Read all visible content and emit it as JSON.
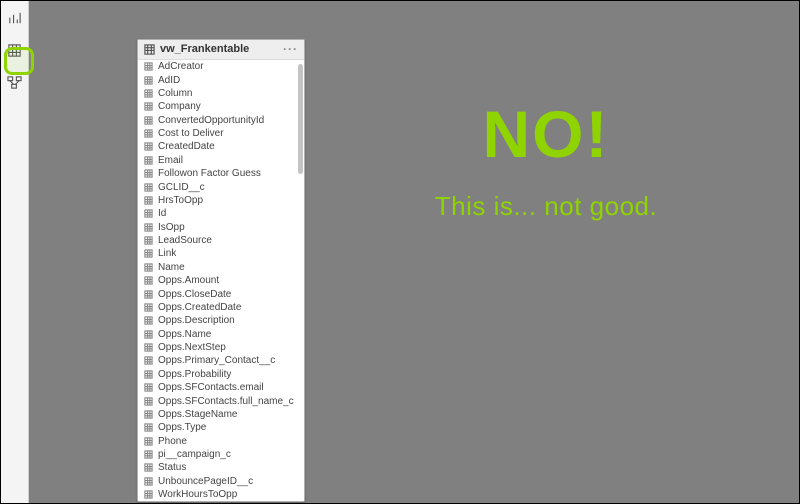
{
  "rail": {
    "icons": [
      "report-icon",
      "data-icon",
      "model-icon"
    ]
  },
  "table": {
    "title": "vw_Frankentable",
    "fields": [
      "AdCreator",
      "AdID",
      "Column",
      "Company",
      "ConvertedOpportunityId",
      "Cost to Deliver",
      "CreatedDate",
      "Email",
      "Followon Factor Guess",
      "GCLID__c",
      "HrsToOpp",
      "Id",
      "IsOpp",
      "LeadSource",
      "Link",
      "Name",
      "Opps.Amount",
      "Opps.CloseDate",
      "Opps.CreatedDate",
      "Opps.Description",
      "Opps.Name",
      "Opps.NextStep",
      "Opps.Primary_Contact__c",
      "Opps.Probability",
      "Opps.SFContacts.email",
      "Opps.SFContacts.full_name_c",
      "Opps.StageName",
      "Opps.Type",
      "Phone",
      "pi__campaign_c",
      "Status",
      "UnbouncePageID__c",
      "WorkHoursToOpp"
    ]
  },
  "commentary": {
    "big": "NO!",
    "sub": "This is... not good."
  }
}
